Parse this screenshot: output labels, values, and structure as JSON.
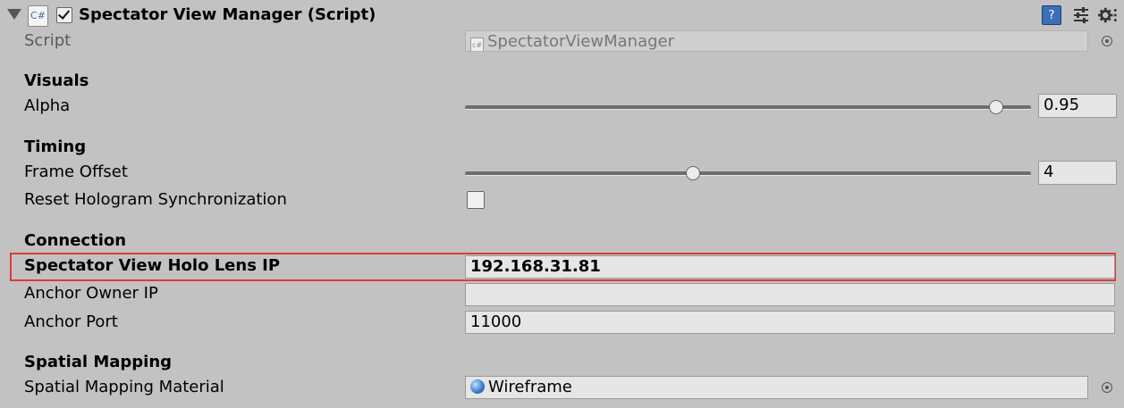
{
  "component": {
    "title": "Spectator View Manager (Script)",
    "enabled": true,
    "script_icon": "C#"
  },
  "header_icons": [
    "help-book-icon",
    "preset-sliders-icon",
    "gear-icon"
  ],
  "script_row": {
    "label": "Script",
    "value": "SpectatorViewManager",
    "icon": "csharp-script-icon"
  },
  "sections": {
    "visuals": "Visuals",
    "timing": "Timing",
    "connection": "Connection",
    "spatial_mapping": "Spatial Mapping"
  },
  "alpha": {
    "label": "Alpha",
    "value": "0.95",
    "slider_fraction": 0.95
  },
  "frame_offset": {
    "label": "Frame Offset",
    "value": "4",
    "slider_fraction": 0.4
  },
  "reset_sync": {
    "label": "Reset Hologram Synchronization",
    "checked": false
  },
  "holo_ip": {
    "label": "Spectator View Holo Lens IP",
    "value": "192.168.31.81"
  },
  "anchor_owner_ip": {
    "label": "Anchor Owner IP",
    "value": ""
  },
  "anchor_port": {
    "label": "Anchor Port",
    "value": "11000"
  },
  "spatial_material": {
    "label": "Spatial Mapping Material",
    "value": "Wireframe",
    "icon": "material-sphere-icon"
  },
  "colors": {
    "highlight": "#e03a3a",
    "background": "#c2c2c2"
  }
}
